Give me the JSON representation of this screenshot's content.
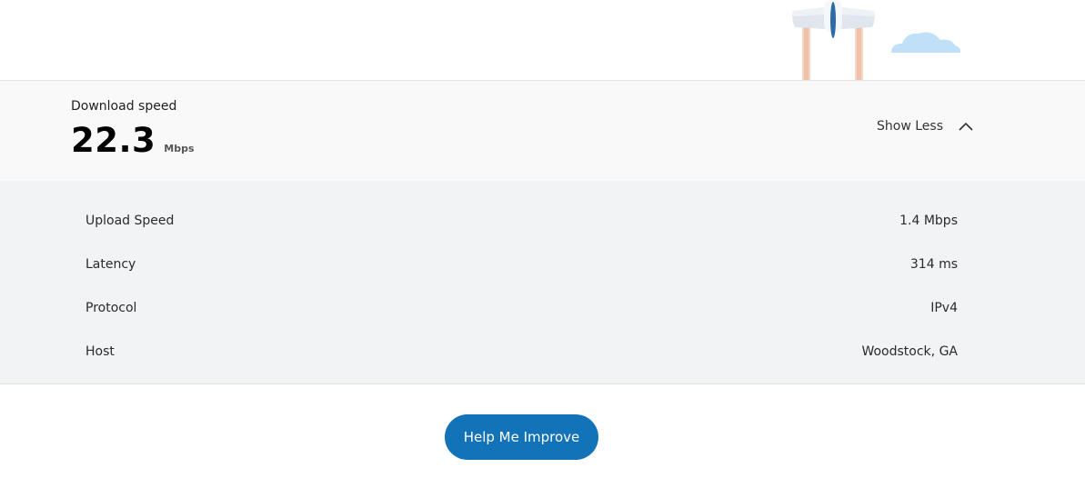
{
  "summary": {
    "label": "Download speed",
    "value": "22.3",
    "unit": "Mbps",
    "toggle_label": "Show Less",
    "toggle_icon": "chevron-up-icon"
  },
  "details": [
    {
      "label": "Upload Speed",
      "value": "1.4 Mbps"
    },
    {
      "label": "Latency",
      "value": "314 ms"
    },
    {
      "label": "Protocol",
      "value": "IPv4"
    },
    {
      "label": "Host",
      "value": "Woodstock, GA"
    }
  ],
  "cta": {
    "label": "Help Me Improve"
  },
  "illustration": {
    "icons": [
      "airplane-icon",
      "cloud-icon"
    ]
  },
  "colors": {
    "accent": "#1273b8",
    "details_bg": "#f2f3f5",
    "summary_bg": "#f9f9f9",
    "cloud": "#bfe0f7",
    "trail": "#f3c9b6"
  }
}
